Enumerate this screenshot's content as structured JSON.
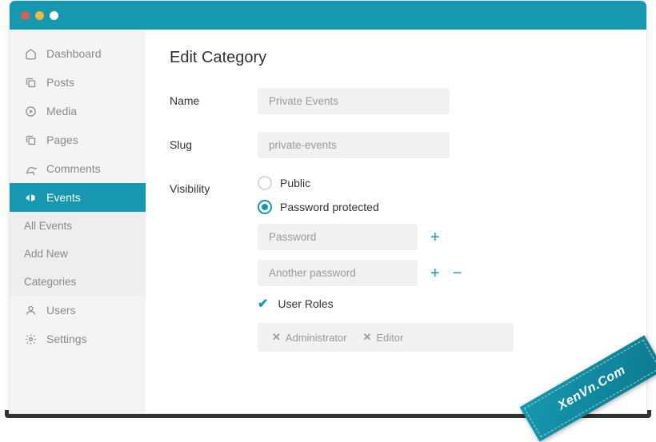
{
  "sidebar": {
    "items": [
      {
        "label": "Dashboard"
      },
      {
        "label": "Posts"
      },
      {
        "label": "Media"
      },
      {
        "label": "Pages"
      },
      {
        "label": "Comments"
      },
      {
        "label": "Events"
      },
      {
        "label": "Users"
      },
      {
        "label": "Settings"
      }
    ],
    "sub": [
      {
        "label": "All Events"
      },
      {
        "label": "Add New"
      },
      {
        "label": "Categories"
      }
    ]
  },
  "page": {
    "title": "Edit Category",
    "labels": {
      "name": "Name",
      "slug": "Slug",
      "visibility": "Visibility"
    }
  },
  "form": {
    "name_placeholder": "Private Events",
    "slug_placeholder": "private-events",
    "visibility": {
      "public_label": "Public",
      "password_label": "Password protected",
      "passwords": [
        {
          "placeholder": "Password"
        },
        {
          "placeholder": "Another password"
        }
      ],
      "user_roles_label": "User Roles",
      "roles": [
        {
          "name": "Administrator"
        },
        {
          "name": "Editor"
        }
      ]
    }
  },
  "watermark": "XenVn.Com"
}
